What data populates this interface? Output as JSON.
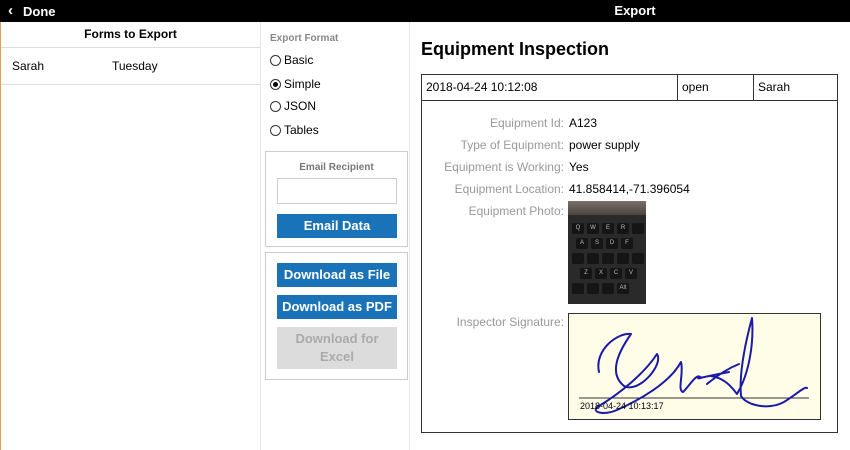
{
  "topbar": {
    "back_label": "Done",
    "title": "Export"
  },
  "forms": {
    "header": "Forms to Export",
    "rows": [
      {
        "name": "Sarah",
        "day": "Tuesday"
      }
    ]
  },
  "export": {
    "format_title": "Export Format",
    "formats": [
      {
        "label": "Basic",
        "selected": false
      },
      {
        "label": "Simple",
        "selected": true
      },
      {
        "label": "JSON",
        "selected": false
      },
      {
        "label": "Tables",
        "selected": false
      }
    ],
    "email_label": "Email Recipient",
    "email_value": "",
    "email_button": "Email Data",
    "download_file": "Download as File",
    "download_pdf": "Download as PDF",
    "download_excel": "Download for Excel"
  },
  "doc": {
    "title": "Equipment Inspection",
    "meta": {
      "datetime": "2018-04-24 10:12:08",
      "status": "open",
      "user": "Sarah"
    },
    "fields": [
      {
        "label": "Equipment Id:",
        "value": "A123"
      },
      {
        "label": "Type of Equipment:",
        "value": "power supply"
      },
      {
        "label": "Equipment is Working:",
        "value": "Yes"
      },
      {
        "label": "Equipment Location:",
        "value": "41.858414,-71.396054"
      }
    ],
    "photo_label": "Equipment Photo:",
    "photo_keys": [
      "Q",
      "W",
      "E",
      "R",
      "A",
      "S",
      "D",
      "F",
      "Z",
      "X",
      "C",
      "V",
      "Alt"
    ],
    "signature_label": "Inspector Signature:",
    "signature_date": "2018-04-24 10:13:17"
  }
}
